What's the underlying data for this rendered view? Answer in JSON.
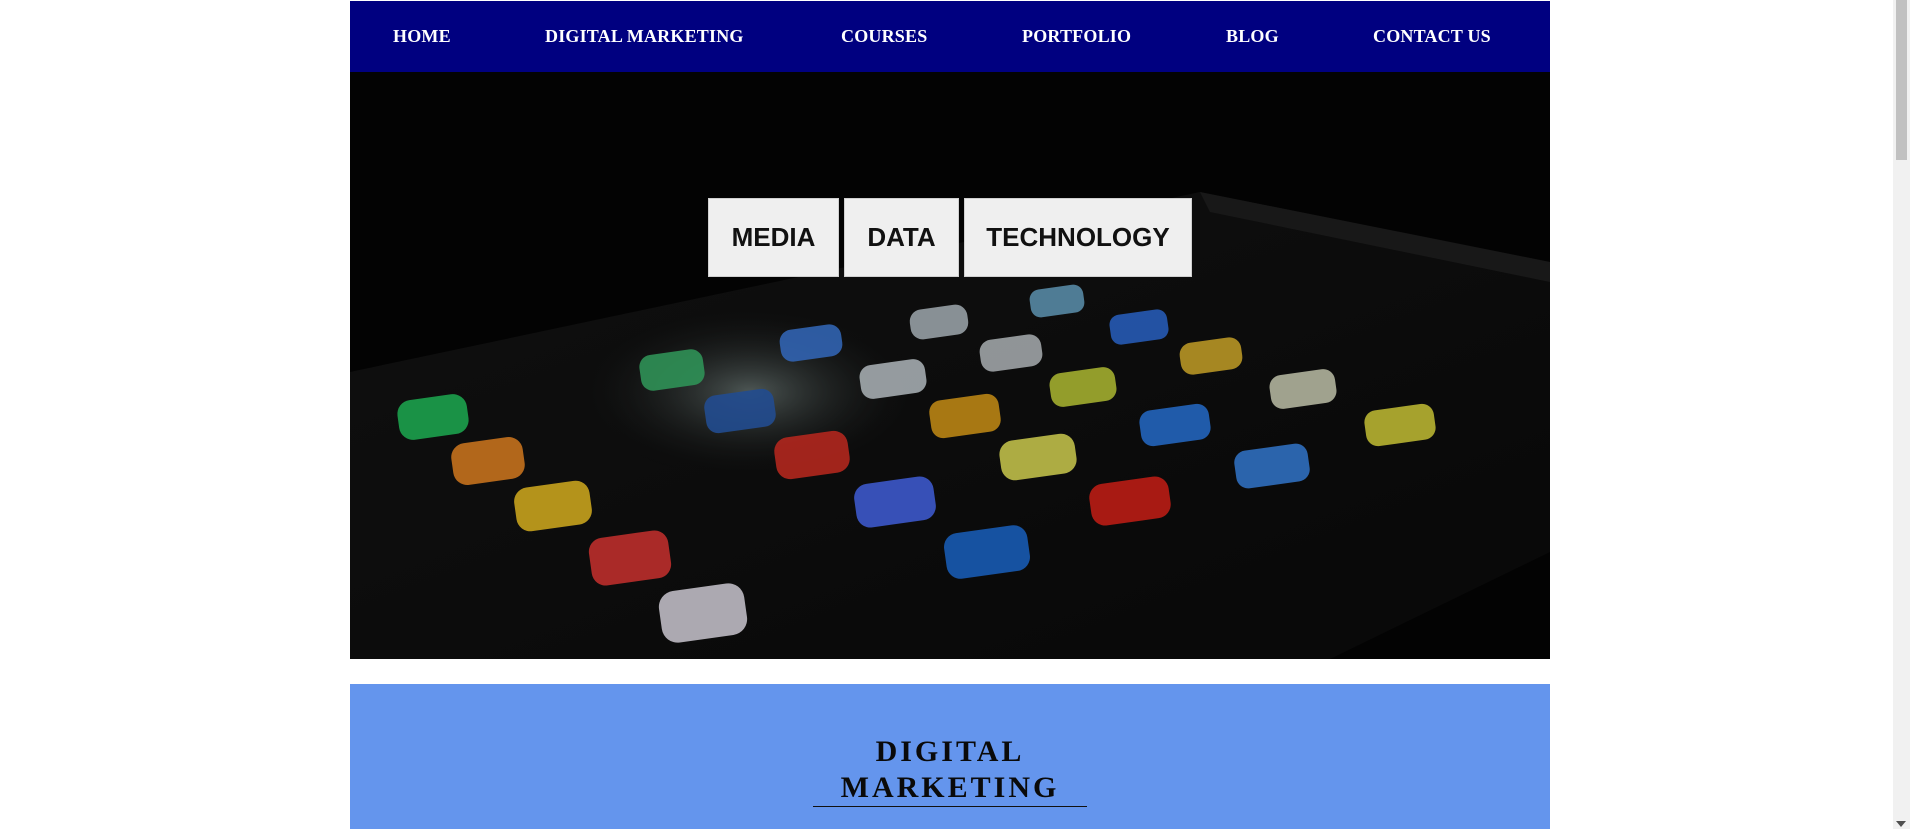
{
  "nav": {
    "items": [
      {
        "label": "HOME"
      },
      {
        "label": "DIGITAL MARKETING"
      },
      {
        "label": "COURSES"
      },
      {
        "label": "PORTFOLIO"
      },
      {
        "label": "BLOG"
      },
      {
        "label": "CONTACT US"
      }
    ]
  },
  "hero": {
    "buttons": [
      {
        "label": "MEDIA"
      },
      {
        "label": "DATA"
      },
      {
        "label": "TECHNOLOGY"
      }
    ],
    "image_subject": "smartphone-app-icons-photo"
  },
  "section": {
    "title_line1": "DIGITAL",
    "title_line2": "MARKETING"
  },
  "colors": {
    "nav_bg": "#000080",
    "section_bg": "#6495ed",
    "hero_bg": "#040404",
    "button_bg": "#efefef"
  }
}
